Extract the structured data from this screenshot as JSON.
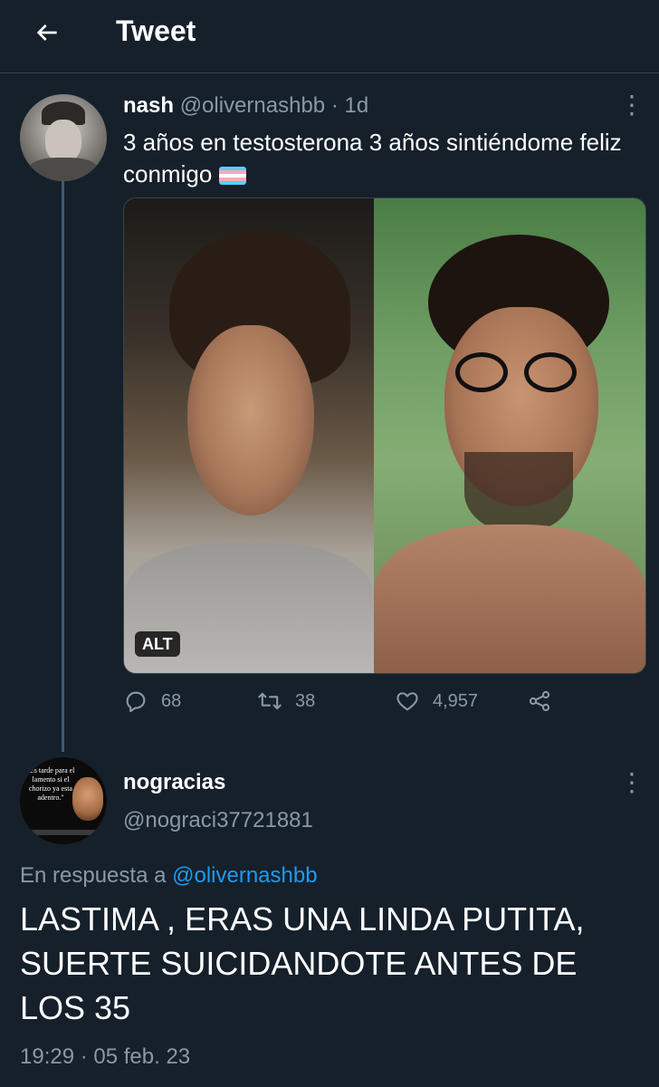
{
  "header": {
    "title": "Tweet",
    "back_icon": "arrow-left-icon"
  },
  "tweet": {
    "author_name": "nash",
    "author_handle": "@olivernashbb",
    "time_ago": "· 1d",
    "text": "3 años en testosterona 3 años sintiéndome feliz conmigo",
    "flag_emoji": "transgender-flag",
    "media_alt_badge": "ALT",
    "stats": {
      "replies": "68",
      "retweets": "38",
      "likes": "4,957"
    }
  },
  "reply": {
    "author_name": "nogracias",
    "author_handle": "@nograci37721881",
    "reply_to_prefix": "En respuesta a",
    "reply_to_handle": "@olivernashbb",
    "text": "LASTIMA , ERAS UNA LINDA PUTITA, SUERTE SUICIDANDOTE ANTES DE LOS 35",
    "timestamp": "19:29 · 05 feb. 23",
    "avatar_text": "\"Es tarde para el lamento si el chorizo ya esta adentro.\""
  },
  "colors": {
    "background": "#15202b",
    "muted": "#8b98a5",
    "link": "#1d9bf0",
    "border": "#38444d"
  }
}
